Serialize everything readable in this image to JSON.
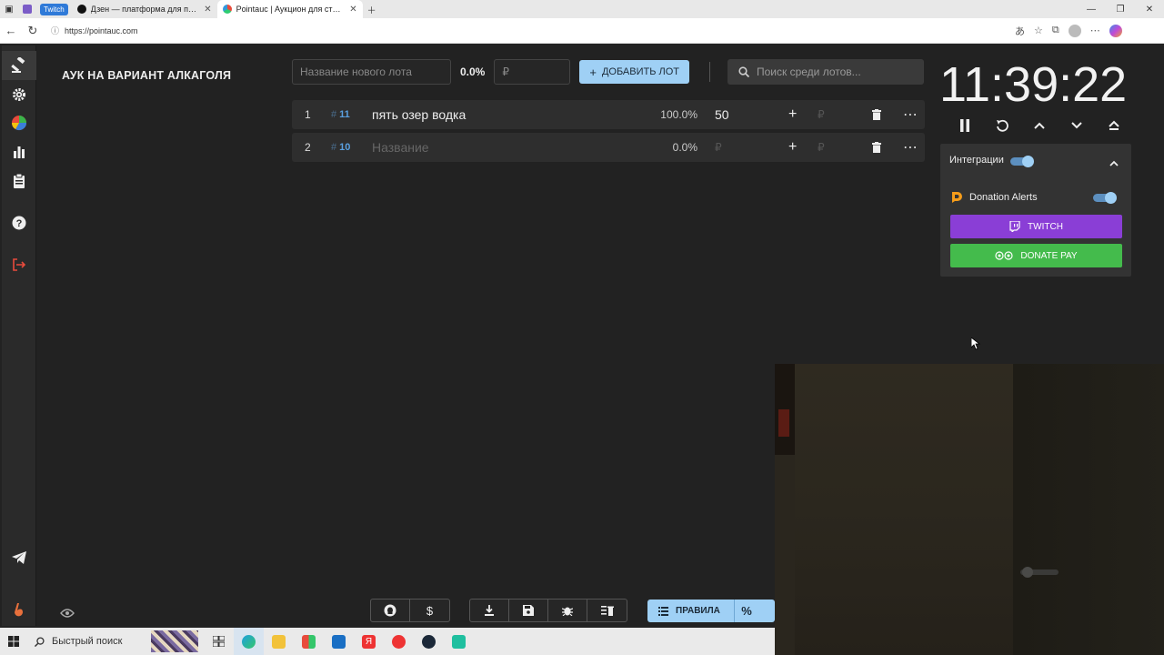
{
  "browser": {
    "pinned_tab_label": "Twitch",
    "tabs": [
      {
        "title": "Дзен — платформа для просмотра"
      },
      {
        "title": "Pointauc | Аукцион для стримеров"
      }
    ],
    "url": "https://pointauc.com"
  },
  "app": {
    "auction_title": "АУК НА ВАРИАНТ АЛКАГОЛЯ",
    "new_lot_placeholder": "Название нового лота",
    "new_lot_percent": "0.0%",
    "new_lot_amount_placeholder": "₽",
    "add_lot_label": "ДОБАВИТЬ ЛОТ",
    "search_placeholder": "Поиск среди лотов...",
    "lots": [
      {
        "index": "1",
        "id": "11",
        "name": "пять озер водка",
        "percent": "100.0%",
        "amount": "50",
        "rub": "₽"
      },
      {
        "index": "2",
        "id": "10",
        "name": "Название",
        "percent": "0.0%",
        "amount": "₽",
        "rub": "₽"
      }
    ],
    "timer": "11:39:22",
    "integrations": {
      "header": "Интеграции",
      "donation_alerts": "Donation Alerts",
      "twitch_button": "TWITCH",
      "donatepay_button": "DONATE PAY"
    },
    "rules_label": "ПРАВИЛА",
    "rules_percent": "%"
  },
  "taskbar": {
    "search_label": "Быстрый поиск"
  },
  "colors": {
    "accent": "#9fd0f5",
    "twitch": "#8a3ed6",
    "donatepay": "#44bb4c",
    "lot_id": "#5aa0e0"
  }
}
